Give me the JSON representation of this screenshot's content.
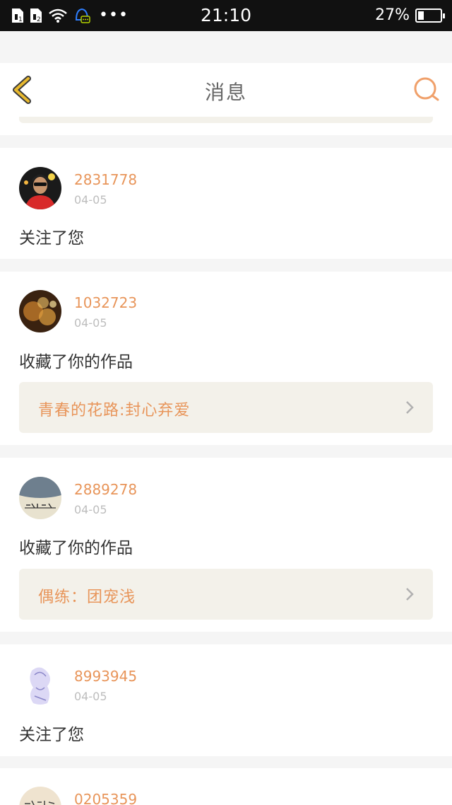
{
  "status_bar": {
    "time": "21:10",
    "battery_percent": "27%",
    "battery_level": 0.27
  },
  "header": {
    "title": "消息"
  },
  "messages": [
    {
      "user": "2831778",
      "date": "04-05",
      "action": "关注了您"
    },
    {
      "user": "1032723",
      "date": "04-05",
      "action": "收藏了你的作品",
      "work_title": "青春的花路:封心弃爱"
    },
    {
      "user": "2889278",
      "date": "04-05",
      "action": "收藏了你的作品",
      "work_title": "偶练：团宠浅"
    },
    {
      "user": "8993945",
      "date": "04-05",
      "action": "关注了您"
    },
    {
      "user": "0205359"
    }
  ],
  "colors": {
    "accent": "#e8955a",
    "back_icon": "#e8b92f",
    "link_bg": "#f3f1ea"
  }
}
